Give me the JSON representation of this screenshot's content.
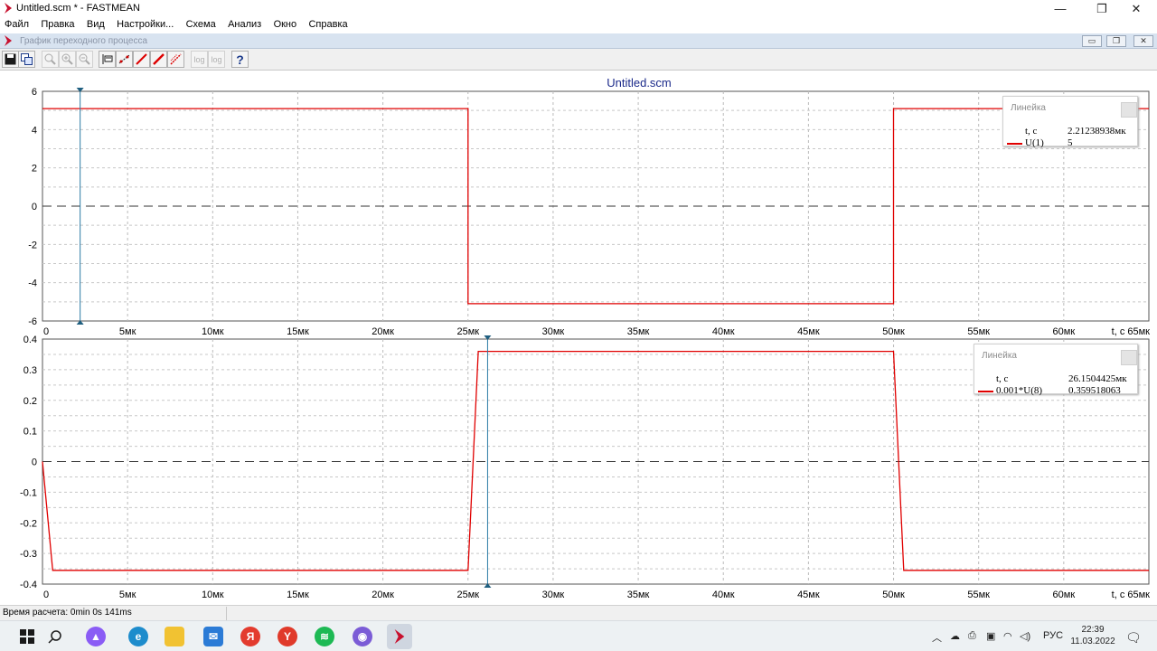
{
  "window": {
    "title": "Untitled.scm * - FASTMEAN",
    "minimize": "—",
    "maximize": "❐",
    "close": "✕"
  },
  "menu": [
    "Файл",
    "Правка",
    "Вид",
    "Настройки...",
    "Схема",
    "Анализ",
    "Окно",
    "Справка"
  ],
  "subwindow": {
    "title": "График переходного процесса",
    "buttons": [
      "▭",
      "❐",
      "✕"
    ]
  },
  "toolbar": {
    "icons": [
      "save-icon",
      "copy-icon",
      "zoom-icon",
      "zoom-in-icon",
      "zoom-out-icon",
      "ruler-icon",
      "points-icon",
      "line-icon",
      "line-red-icon",
      "grid-icon",
      "log-x-icon",
      "log-y-icon",
      "help-icon"
    ],
    "log_label": "log",
    "help_label": "?"
  },
  "chart_data": [
    {
      "type": "line",
      "title": "Untitled.scm",
      "xlabel": "t, c",
      "x_tick_labels": [
        "0",
        "5мк",
        "10мк",
        "15мк",
        "20мк",
        "25мк",
        "30мк",
        "35мк",
        "40мк",
        "45мк",
        "50мк",
        "55мк",
        "60мк",
        "65мк"
      ],
      "y_tick_labels": [
        "6",
        "4",
        "2",
        "0",
        "-2",
        "-4",
        "-6"
      ],
      "xlim": [
        0,
        65
      ],
      "ylim": [
        -6,
        6
      ],
      "grid": true,
      "series": [
        {
          "name": "U(1)",
          "color": "#e00000",
          "points": [
            [
              0,
              5.1
            ],
            [
              25,
              5.1
            ],
            [
              25,
              -5.1
            ],
            [
              50,
              -5.1
            ],
            [
              50,
              5.1
            ],
            [
              65,
              5.1
            ]
          ]
        }
      ],
      "cursor_x": 2.21238938,
      "ruler": {
        "title": "Линейка",
        "t_label": "t, c",
        "t_value": "2.21238938мк",
        "series_label": "U(1)",
        "series_value": "5"
      }
    },
    {
      "type": "line",
      "title": "",
      "xlabel": "t, c",
      "x_tick_labels": [
        "0",
        "5мк",
        "10мк",
        "15мк",
        "20мк",
        "25мк",
        "30мк",
        "35мк",
        "40мк",
        "45мк",
        "50мк",
        "55мк",
        "60мк",
        "65мк"
      ],
      "y_tick_labels": [
        "0.4",
        "0.3",
        "0.2",
        "0.1",
        "0",
        "-0.1",
        "-0.2",
        "-0.3",
        "-0.4"
      ],
      "xlim": [
        0,
        65
      ],
      "ylim": [
        -0.4,
        0.4
      ],
      "grid": true,
      "series": [
        {
          "name": "0.001*U(8)",
          "color": "#e00000",
          "points": [
            [
              0,
              0
            ],
            [
              0.6,
              -0.355
            ],
            [
              25,
              -0.355
            ],
            [
              25.6,
              0.36
            ],
            [
              50,
              0.36
            ],
            [
              50.6,
              -0.355
            ],
            [
              65,
              -0.355
            ]
          ]
        }
      ],
      "cursor_x": 26.1504425,
      "ruler": {
        "title": "Линейка",
        "t_label": "t, c",
        "t_value": "26.1504425мк",
        "series_label": "0.001*U(8)",
        "series_value": "0.359518063"
      }
    }
  ],
  "status": {
    "calc_time": "Время расчета: 0min 0s 141ms"
  },
  "taskbar": {
    "apps": [
      {
        "icon": "windows-start-icon",
        "color": "#1a1a1a"
      },
      {
        "icon": "search-icon",
        "color": "#1a1a1a"
      },
      {
        "icon": "alice-icon",
        "color": "#8a5cf5"
      },
      {
        "icon": "edge-icon",
        "color": "#1d8ccc"
      },
      {
        "icon": "explorer-icon",
        "color": "#f1c232"
      },
      {
        "icon": "mail-icon",
        "color": "#2b7bd6"
      },
      {
        "icon": "yandex-icon",
        "color": "#e33b2e"
      },
      {
        "icon": "yandex-browser-icon",
        "color": "#e03a2a"
      },
      {
        "icon": "spotify-icon",
        "color": "#1db954"
      },
      {
        "icon": "discord-icon",
        "color": "#7b5cd6"
      },
      {
        "icon": "fastmean-icon",
        "color": "#c8102e"
      }
    ],
    "lang": "РУС",
    "time": "22:39",
    "date": "11.03.2022"
  }
}
